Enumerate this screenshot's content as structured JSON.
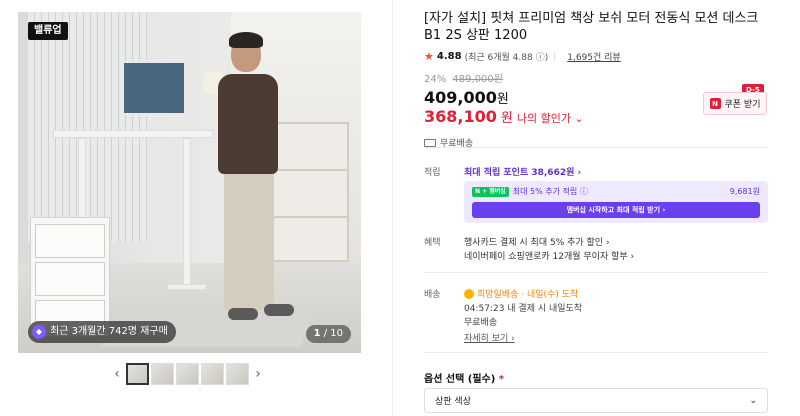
{
  "gallery": {
    "brand_tag": "밸류업",
    "repurchase_text": "최근 3개월간 742명 재구매",
    "counter_current": "1",
    "counter_total": "/ 10",
    "prev": "‹",
    "next": "›"
  },
  "product": {
    "title": "[자가 설치] 핏쳐 프리미엄 책상 보쉬 모터 전동식 모션 데스크 B1 2S 상판 1200",
    "rating": "4.88",
    "rating_recent": "(최근 6개월 4.88",
    "review_count": "1,695건 리뷰",
    "discount_pct": "24%",
    "original_price": "489,000원",
    "price": "409,000",
    "price_unit": "원",
    "my_price": "368,100",
    "my_price_unit": "원",
    "my_price_label": "나의 할인가 ⌄",
    "shipping": "무료배송"
  },
  "coupon": {
    "dday": "D-5",
    "label": "쿠폰 받기"
  },
  "points": {
    "label": "적립",
    "max_points": "최대 적립 포인트 38,662원 ›",
    "np_logo": "N + 멤버십",
    "np_extra": "최대 5% 추가 적립 ⓘ",
    "np_amount": "9,681원",
    "np_button": "멤버십 시작하고 최대 적립 받기 ›"
  },
  "benefits": {
    "label": "혜택",
    "line1": "행사카드 결제 시 최대 5% 추가 할인 ›",
    "line2": "네이버페이 쇼핑앤로카 12개월 무이자 할부 ›"
  },
  "delivery": {
    "label": "배송",
    "tag": "희망일배송 · 내일(수) 도착",
    "cutoff": "04:57:23  내 결제 시 내일도착",
    "free": "무료배송",
    "detail": "자세히 보기 ›"
  },
  "options": {
    "label": "옵션 선택 (필수)",
    "required_mark": "*",
    "selected": "상판 색상",
    "chevron": "⌄"
  },
  "colors": {
    "accent_red": "#e0203a",
    "accent_purple": "#5b2fd6",
    "naver_green": "#03c75a"
  }
}
